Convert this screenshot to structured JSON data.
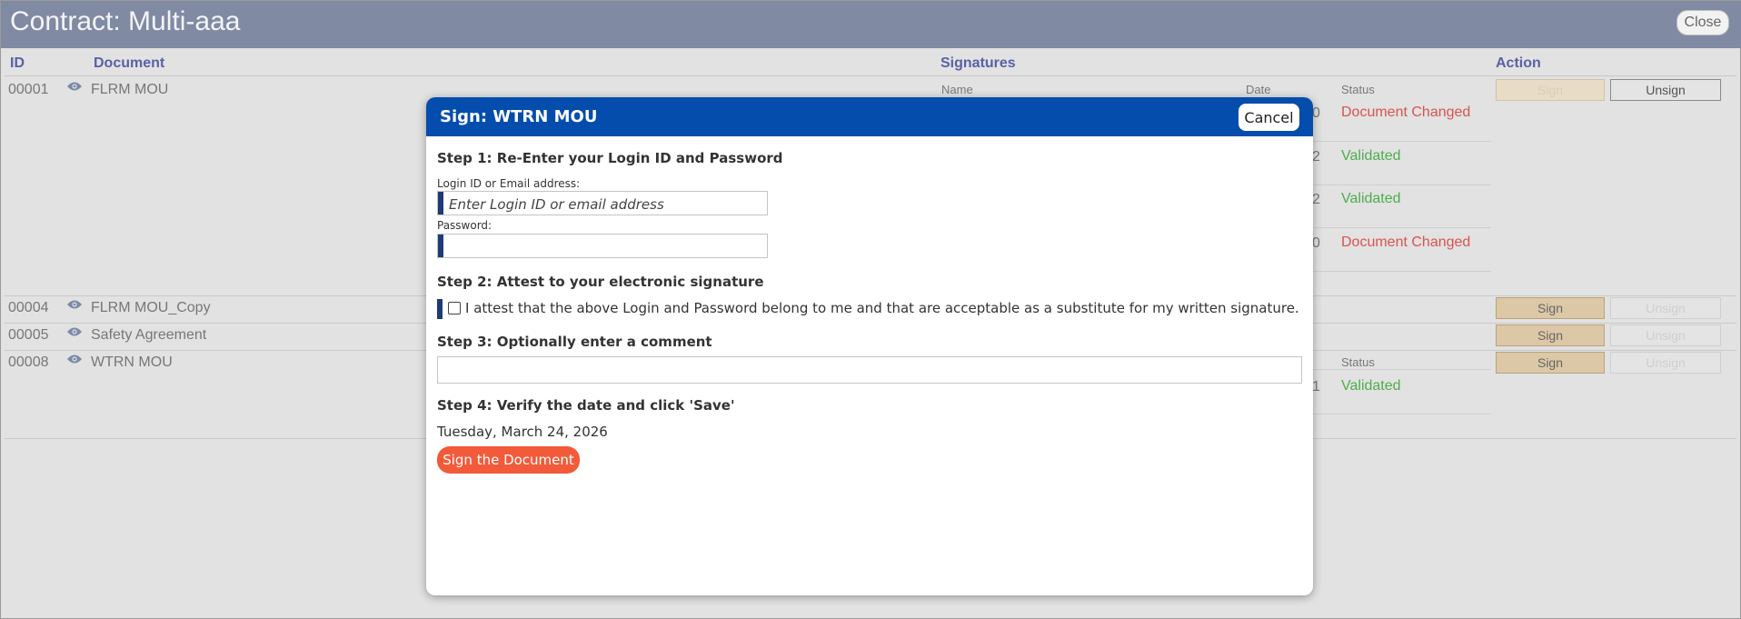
{
  "window": {
    "title": "Contract: Multi-aaa",
    "close_label": "Close"
  },
  "columns": {
    "id": "ID",
    "document": "Document",
    "signatures": "Signatures",
    "action": "Action"
  },
  "sig_subheaders": {
    "name": "Name",
    "date": "Date",
    "status": "Status"
  },
  "rows": [
    {
      "id": "00001",
      "document": "FLRM MOU",
      "sign_label": "Sign",
      "unsign_label": "Unsign",
      "sig_statuses": [
        "Document Changed",
        "Validated",
        "Validated",
        "Document Changed"
      ],
      "date_fragments": [
        "0",
        "2",
        "2",
        "0"
      ]
    },
    {
      "id": "00004",
      "document": "FLRM MOU_Copy",
      "sign_label": "Sign",
      "unsign_label": "Unsign"
    },
    {
      "id": "00005",
      "document": "Safety Agreement",
      "sign_label": "Sign",
      "unsign_label": "Unsign"
    },
    {
      "id": "00008",
      "document": "WTRN MOU",
      "sign_label": "Sign",
      "unsign_label": "Unsign",
      "sig_statuses": [
        "Validated"
      ],
      "date_fragments": [
        "1"
      ]
    }
  ],
  "modal": {
    "title": "Sign: WTRN MOU",
    "cancel_label": "Cancel",
    "step1": "Step 1: Re-Enter your Login ID and Password",
    "login_label": "Login ID or Email address:",
    "login_placeholder": "Enter Login ID or email address",
    "password_label": "Password:",
    "step2": "Step 2: Attest to your electronic signature",
    "attest_text": "I attest that the above Login and Password belong to me and that are acceptable as a substitute for my written signature.",
    "step3": "Step 3: Optionally enter a comment",
    "step4": "Step 4: Verify the date and click 'Save'",
    "date_value": "Tuesday, March 24, 2026",
    "sign_button": "Sign the Document"
  },
  "colors": {
    "header_bar": "#808aa3",
    "modal_header": "#044dad",
    "sign_doc_button": "#f25a3a",
    "status_red": "#d9534f",
    "status_green": "#4cae4c",
    "column_header": "#5961a6"
  },
  "icons": {
    "view": "eye-icon"
  }
}
